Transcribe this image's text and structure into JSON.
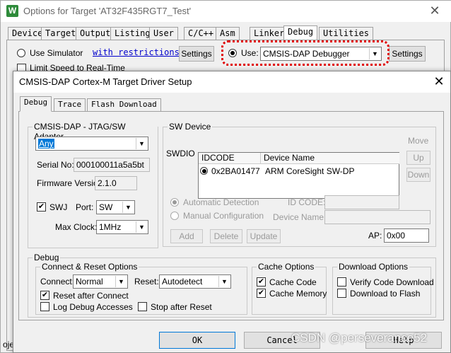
{
  "outer": {
    "icon": "W",
    "title": "Options for Target 'AT32F435RGT7_Test'",
    "close": "✕",
    "tabs": [
      {
        "label": "Device"
      },
      {
        "label": "Target"
      },
      {
        "label": "Output"
      },
      {
        "label": "Listing"
      },
      {
        "label": "User"
      },
      {
        "label": "C/C++"
      },
      {
        "label": "Asm"
      },
      {
        "label": "Linker"
      },
      {
        "label": "Debug"
      },
      {
        "label": "Utilities"
      }
    ],
    "use_simulator": "Use Simulator",
    "with_restrictions": "with restrictions",
    "settings_left": "Settings",
    "limit_speed": "Limit Speed to Real-Time",
    "use_label": "Use:",
    "debugger": "CMSIS-DAP Debugger",
    "settings_right": "Settings",
    "bottom_partial": "oje",
    "highlight_color": "#e00000"
  },
  "inner": {
    "title": "CMSIS-DAP Cortex-M Target Driver Setup",
    "close": "✕",
    "tabs": [
      {
        "label": "Debug"
      },
      {
        "label": "Trace"
      },
      {
        "label": "Flash Download"
      }
    ],
    "adapter": {
      "group_label": "CMSIS-DAP - JTAG/SW Adapter",
      "selected": "Any",
      "serial_label": "Serial No:",
      "serial_value": "000100011a5a5bt",
      "firmware_label": "Firmware Version:",
      "firmware_value": "2.1.0",
      "swj_label": "SWJ",
      "port_label": "Port:",
      "port_value": "SW",
      "max_clock_label": "Max Clock:",
      "max_clock_value": "1MHz"
    },
    "sw_device": {
      "group_label": "SW Device",
      "swdio_label": "SWDIO",
      "col_idcode": "IDCODE",
      "col_device_name": "Device Name",
      "row_idcode": "0x2BA01477",
      "row_device": "ARM CoreSight SW-DP",
      "move_label": "Move",
      "up_label": "Up",
      "down_label": "Down",
      "auto_detect": "Automatic Detection",
      "manual_config": "Manual Configuration",
      "id_code_label": "ID CODE:",
      "device_name_label": "Device Name:",
      "add_label": "Add",
      "delete_label": "Delete",
      "update_label": "Update",
      "ap_label": "AP:",
      "ap_value": "0x00"
    },
    "debug": {
      "group_label": "Debug",
      "connect_reset": {
        "group_label": "Connect & Reset Options",
        "connect_label": "Connect:",
        "connect_value": "Normal",
        "reset_label": "Reset:",
        "reset_value": "Autodetect",
        "reset_after_connect": "Reset after Connect",
        "log_debug": "Log Debug Accesses",
        "stop_after_reset": "Stop after Reset"
      },
      "cache": {
        "group_label": "Cache Options",
        "cache_code": "Cache Code",
        "cache_memory": "Cache Memory"
      },
      "download": {
        "group_label": "Download Options",
        "verify": "Verify Code Download",
        "download_flash": "Download to Flash"
      }
    },
    "ok_label": "OK",
    "cancel_label": "Cancel",
    "help_label": "Help"
  },
  "watermark": "CSDN @perseverance52"
}
